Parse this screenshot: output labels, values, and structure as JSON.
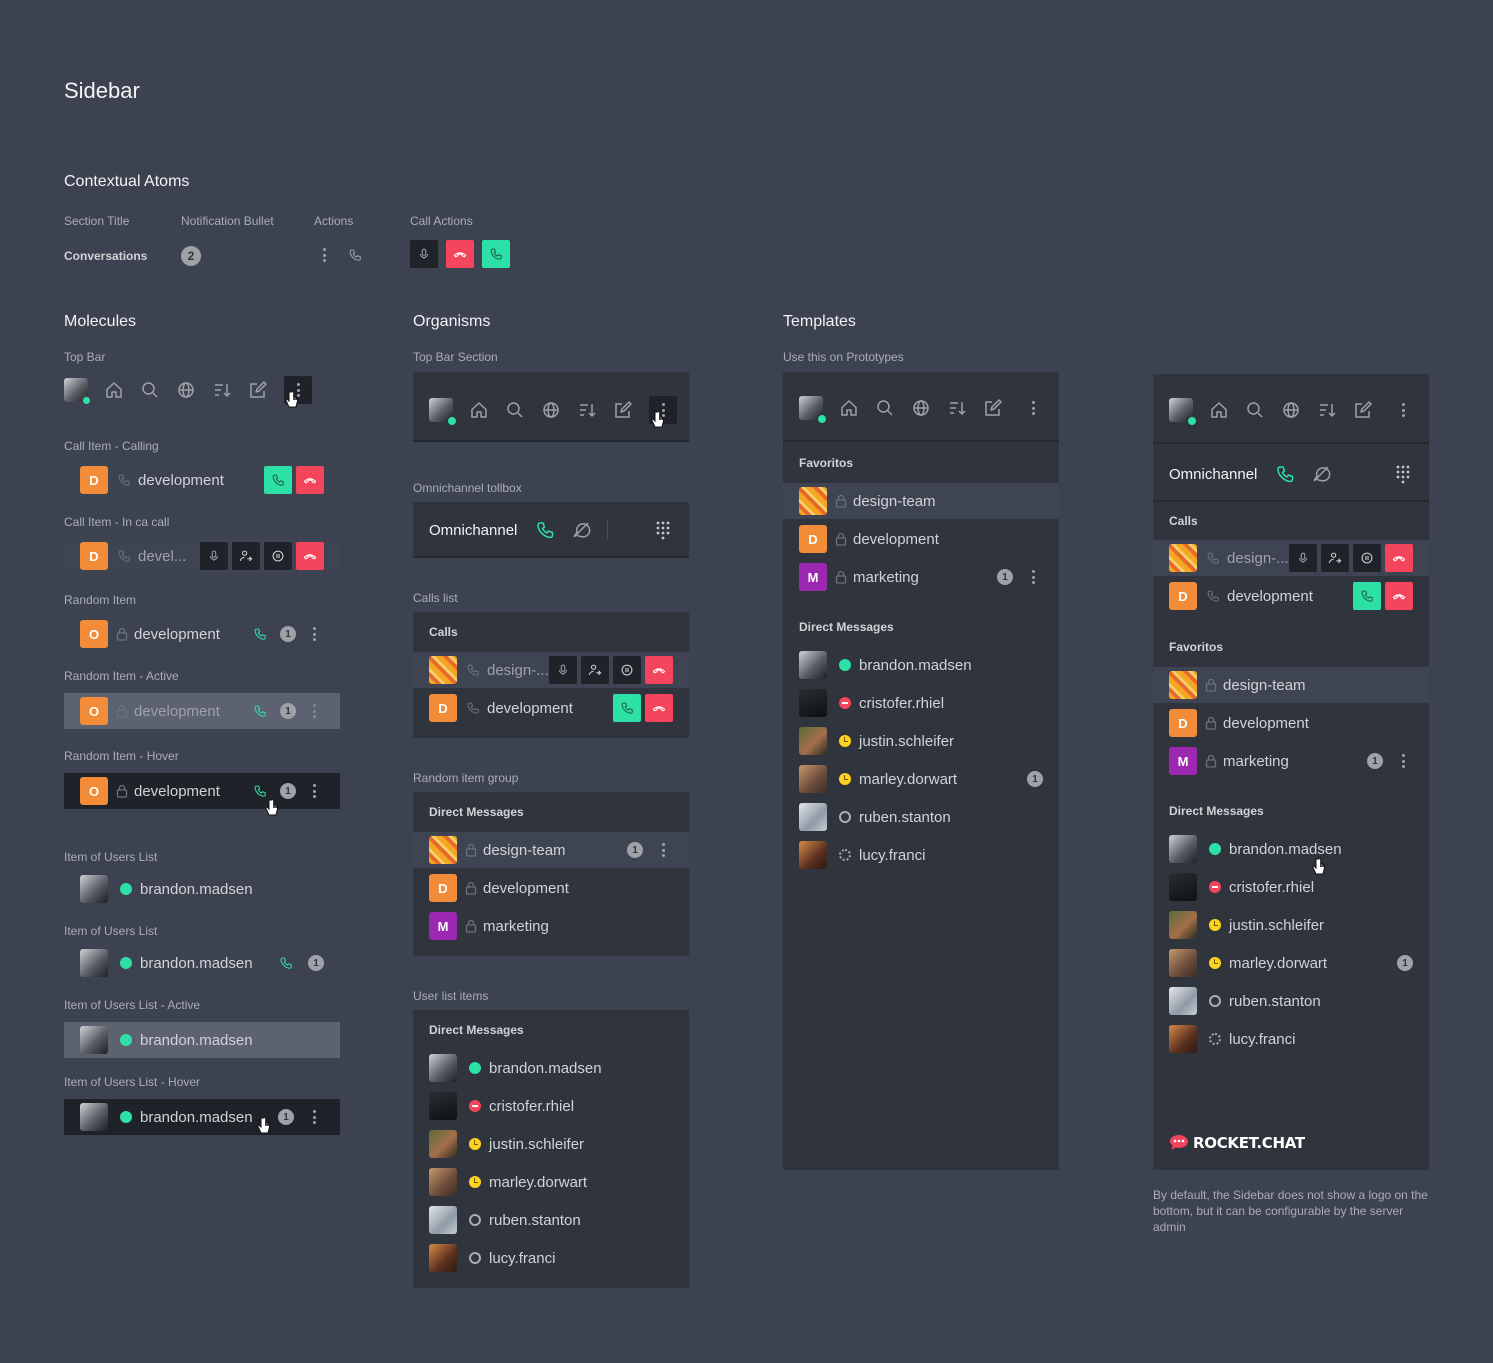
{
  "page": {
    "title": "Sidebar"
  },
  "atoms": {
    "heading": "Contextual Atoms",
    "section_title_label": "Section Title",
    "section_title_value": "Conversations",
    "notification_label": "Notification Bullet",
    "notification_value": "2",
    "actions_label": "Actions",
    "call_actions_label": "Call Actions"
  },
  "molecules": {
    "heading": "Molecules",
    "top_bar_label": "Top Bar",
    "call_calling_label": "Call Item - Calling",
    "call_incall_label": "Call Item - In ca call",
    "random_label": "Random Item",
    "random_active_label": "Random Item - Active",
    "random_hover_label": "Random Item - Hover",
    "users_list_label": "Item of Users List",
    "users_list2_label": "Item of Users List",
    "users_active_label": "Item of Users List - Active",
    "users_hover_label": "Item of Users List - Hover",
    "channel": "development",
    "channel_short": "devel...",
    "avatar_d": "D",
    "avatar_o": "O",
    "user": "brandon.madsen",
    "badge": "1"
  },
  "organisms": {
    "heading": "Organisms",
    "top_bar_section_label": "Top Bar Section",
    "omni_label": "Omnichannel tollbox",
    "omni_title": "Omnichannel",
    "calls_list_label": "Calls list",
    "calls_title": "Calls",
    "call1": "design-...",
    "call2": "development",
    "random_group_label": "Random item group",
    "dm_title": "Direct Messages",
    "group_items": [
      "design-team",
      "development",
      "marketing"
    ],
    "user_list_label": "User list items",
    "dm_title2": "Direct Messages",
    "users": [
      "brandon.madsen",
      "cristofer.rhiel",
      "justin.schleifer",
      "marley.dorwart",
      "ruben.stanton",
      "lucy.franci"
    ],
    "badge": "1",
    "avatar_d": "D",
    "avatar_m": "M"
  },
  "templates": {
    "heading": "Templates",
    "sub": "Use this on Prototypes",
    "favoritos": "Favoritos",
    "fav_items": [
      "design-team",
      "development",
      "marketing"
    ],
    "dm_title": "Direct Messages",
    "users": [
      "brandon.madsen",
      "cristofer.rhiel",
      "justin.schleifer",
      "marley.dorwart",
      "ruben.stanton",
      "lucy.franci"
    ],
    "badge": "1",
    "omni_title": "Omnichannel",
    "calls_title": "Calls",
    "call1": "design-...",
    "call2": "development",
    "logo": "ROCKET.CHAT",
    "footnote": "By default, the Sidebar does not show a logo on the bottom, but it can be configurable by the server admin",
    "avatar_d": "D",
    "avatar_m": "M"
  },
  "colors": {
    "background": "#3d4250",
    "panel": "#2f343d",
    "green": "#2de0a5",
    "red": "#f5455c",
    "orange": "#f38c39",
    "purple": "#9c27b0"
  }
}
